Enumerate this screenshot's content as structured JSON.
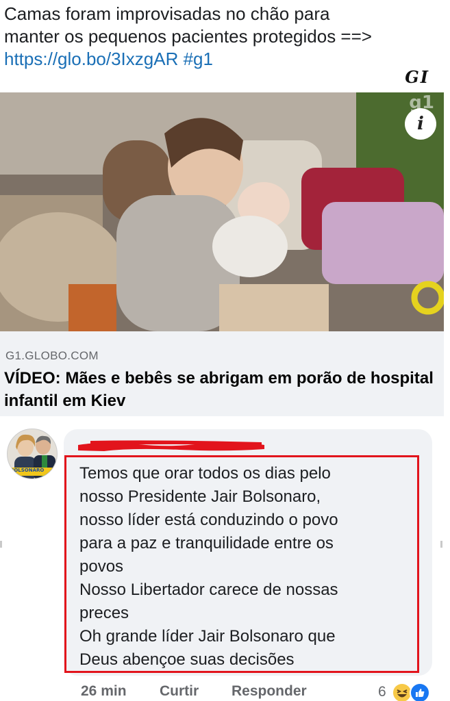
{
  "post": {
    "text_line1": "Camas foram improvisadas no chão para",
    "text_line2": "manter os pequenos pacientes protegidos ==>",
    "link_text": "https://glo.bo/3IxzgAR #g1",
    "source_logo": "GI"
  },
  "preview": {
    "watermark": "g1",
    "info_glyph": "i",
    "image_icon": "mother-feeding-baby-photo"
  },
  "link_card": {
    "domain": "G1.GLOBO.COM",
    "title": "VÍDEO: Mães e bebês se abrigam em porão de hospital infantil em Kiev"
  },
  "comment": {
    "avatar_caption": "BOLSONARO",
    "lines": [
      "Temos que orar todos os dias pelo",
      "nosso Presidente Jair Bolsonaro,",
      "nosso líder está conduzindo o povo",
      "para a paz e tranquilidade entre os",
      "povos",
      "Nosso Libertador carece de nossas",
      "preces",
      "Oh grande líder Jair Bolsonaro que",
      "Deus abençoe suas decisões"
    ],
    "highlight_color": "#e2141c"
  },
  "actions": {
    "time": "26 min",
    "like_label": "Curtir",
    "reply_label": "Responder",
    "reaction_count": "6"
  },
  "colors": {
    "link": "#1a6fb6",
    "muted": "#65676b",
    "bubble": "#f0f2f5",
    "like_blue": "#1877f2",
    "haha_yellow": "#f7c948"
  }
}
